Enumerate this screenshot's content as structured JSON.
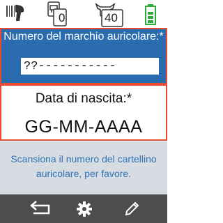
{
  "status_bar": {
    "scanner_icon": "barcode-scanner-icon",
    "animals_icon": "cow-icon",
    "animals_count_left": "0",
    "group_icon": "cow-head-icon",
    "group_count": "40",
    "battery_icon": "battery-icon",
    "battery_level": 0.75,
    "battery_color": "#2eaa3f"
  },
  "eartag": {
    "label": "Numero del marchio auricolare:*",
    "value": "??-----------"
  },
  "birthdate": {
    "label": "Data di nascita:*",
    "value": "GG-MM-AAAA"
  },
  "message": {
    "text": "Scansiona il numero del cartellino auricolare, per favore."
  },
  "toolbar": {
    "back_icon": "back-arrow-icon",
    "settings_icon": "gear-icon",
    "edit_icon": "pencil-icon"
  },
  "colors": {
    "accent_blue": "#2b6bb0",
    "highlight_border": "#e84a32",
    "toolbar_bg": "#4d4d4f",
    "message_bg": "#d7dce3",
    "message_text": "#2f74b5"
  }
}
